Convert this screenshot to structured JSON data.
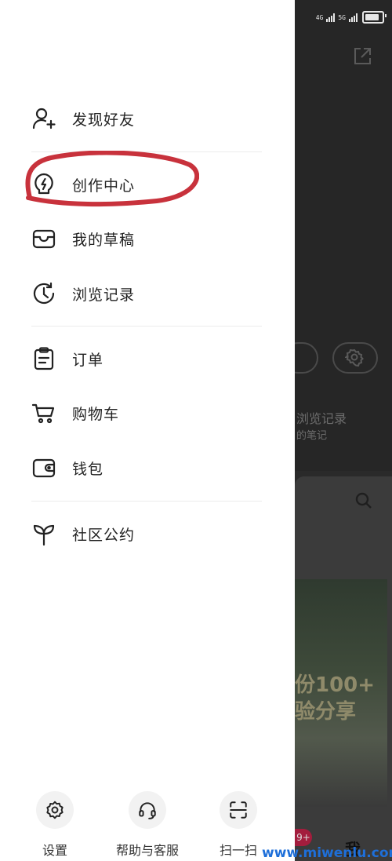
{
  "status": {
    "net1": "4G",
    "net2": "5G"
  },
  "menu": {
    "group1": [
      {
        "label": "发现好友",
        "icon": "add-friend-icon"
      },
      {
        "label": "创作中心",
        "icon": "lightbulb-bolt-icon"
      },
      {
        "label": "我的草稿",
        "icon": "drafts-tray-icon"
      },
      {
        "label": "浏览记录",
        "icon": "history-clock-icon"
      }
    ],
    "group2": [
      {
        "label": "订单",
        "icon": "clipboard-icon"
      },
      {
        "label": "购物车",
        "icon": "cart-icon"
      },
      {
        "label": "钱包",
        "icon": "wallet-icon"
      }
    ],
    "group3": [
      {
        "label": "社区公约",
        "icon": "sprout-icon"
      }
    ]
  },
  "bottom": {
    "settings": {
      "label": "设置",
      "icon": "gear-icon"
    },
    "help": {
      "label": "帮助与客服",
      "icon": "headset-icon"
    },
    "scan": {
      "label": "扫一扫",
      "icon": "scan-icon"
    }
  },
  "background": {
    "browse_history": "浏览记录",
    "notes_hint": "的笔记",
    "photo_text_1": "份100+",
    "photo_text_2": "验分享",
    "badge": "9+",
    "me_tab": "我"
  },
  "watermark": "www.miwenlu.com",
  "colors": {
    "annotation": "#c8323c",
    "watermark": "#1e6fd9"
  }
}
